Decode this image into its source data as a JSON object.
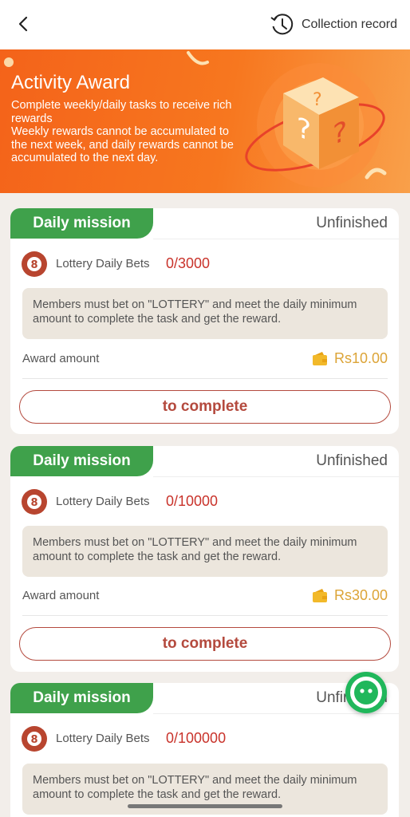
{
  "header": {
    "back_icon": "chevron-left-icon",
    "history_icon": "history-clock-icon",
    "collection_label": "Collection record"
  },
  "banner": {
    "title": "Activity Award",
    "line1": "Complete weekly/daily tasks to receive rich rewards",
    "line2": "Weekly rewards cannot be accumulated to the next week, and daily rewards cannot be accumulated to the next day."
  },
  "missions": [
    {
      "tag": "Daily mission",
      "status": "Unfinished",
      "task_label": "Lottery Daily Bets",
      "progress": "0/3000",
      "note": "Members must bet on \"LOTTERY\" and meet the daily minimum amount to complete the task and get the reward.",
      "award_label": "Award amount",
      "award_value": "Rs10.00",
      "button": "to complete"
    },
    {
      "tag": "Daily mission",
      "status": "Unfinished",
      "task_label": "Lottery Daily Bets",
      "progress": "0/10000",
      "note": "Members must bet on \"LOTTERY\" and meet the daily minimum amount to complete the task and get the reward.",
      "award_label": "Award amount",
      "award_value": "Rs30.00",
      "button": "to complete"
    },
    {
      "tag": "Daily mission",
      "status": "Unfinished",
      "task_label": "Lottery Daily Bets",
      "progress": "0/100000",
      "note": "Members must bet on \"LOTTERY\" and meet the daily minimum amount to complete the task and get the reward."
    }
  ],
  "colors": {
    "accent_green": "#3fa14b",
    "progress_red": "#c9332b",
    "award_gold": "#dca437",
    "banner_orange": "#f4631a"
  }
}
